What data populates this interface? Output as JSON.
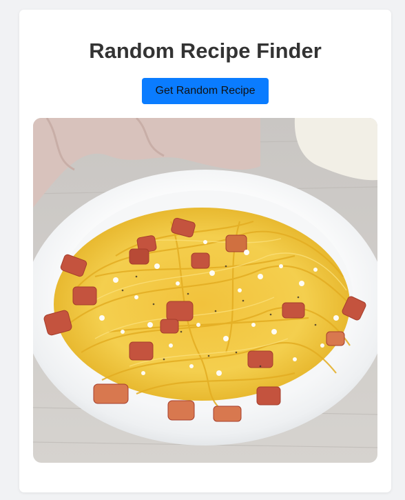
{
  "page": {
    "title": "Random Recipe Finder",
    "button_label": "Get Random Recipe"
  },
  "recipe_image": {
    "description_icon": "pasta-dish-photo"
  },
  "colors": {
    "background": "#f1f2f4",
    "card": "#ffffff",
    "title": "#333333",
    "button": "#0a7cff",
    "button_text": "#111111"
  }
}
